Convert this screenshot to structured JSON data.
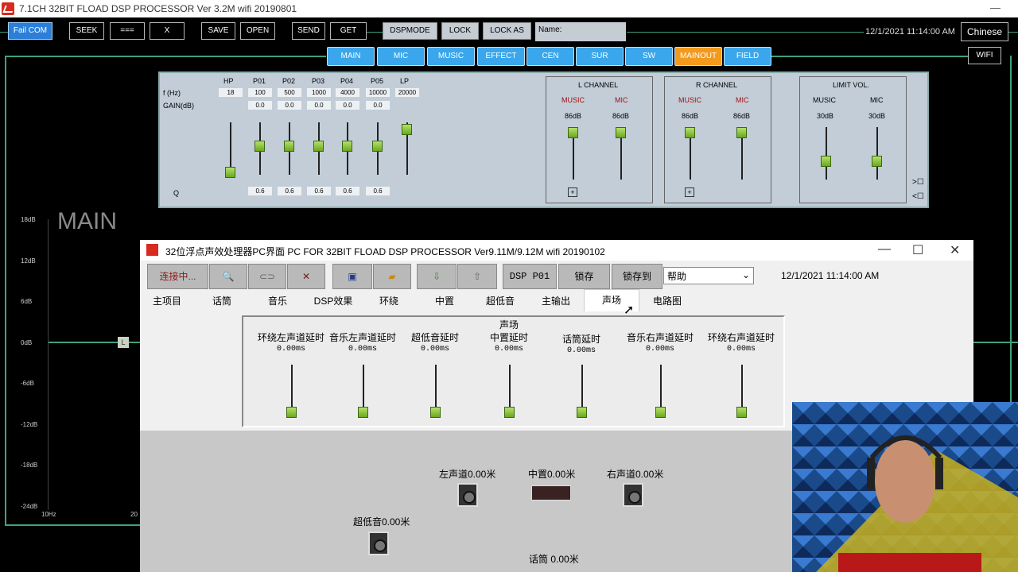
{
  "app": {
    "title": "7.1CH  32BIT FLOAD DSP PROCESSOR   Ver 3.2M   wifi    20190801",
    "minimize": "—"
  },
  "toolbar": {
    "fail_com": "Fail COM",
    "seek": "SEEK",
    "equals": "===",
    "x": "X",
    "save": "SAVE",
    "open": "OPEN",
    "send": "SEND",
    "get": "GET",
    "dspmode": "DSPMODE",
    "lock": "LOCK",
    "lock_as": "LOCK AS",
    "name_label": "Name:",
    "datetime": "12/1/2021 11:14:00 AM",
    "language": "Chinese",
    "wifi": "WIFI"
  },
  "tabs": [
    "MAIN",
    "MIC",
    "MUSIC",
    "EFFECT",
    "CEN",
    "SUR",
    "SW",
    "MAINOUT",
    "FIELD"
  ],
  "active_tab": "MAINOUT",
  "eq": {
    "headers": [
      "HP",
      "P01",
      "P02",
      "P03",
      "P04",
      "P05",
      "LP"
    ],
    "f_label": "f (Hz)",
    "gain_label": "GAIN(dB)",
    "q_label": "Q",
    "freqs": [
      "18",
      "100",
      "500",
      "1000",
      "4000",
      "10000",
      "20000"
    ],
    "gains": [
      "0.0",
      "0.0",
      "0.0",
      "0.0",
      "0.0"
    ],
    "qs": [
      "0.6",
      "0.6",
      "0.6",
      "0.6",
      "0.6"
    ]
  },
  "channels": {
    "l_title": "L CHANNEL",
    "r_title": "R CHANNEL",
    "limit_title": "LIMIT VOL.",
    "music": "MUSIC",
    "mic": "MIC",
    "l_values": [
      "86dB",
      "86dB"
    ],
    "r_values": [
      "86dB",
      "86dB"
    ],
    "limit_values": [
      "30dB",
      "30dB"
    ],
    "plus": "+"
  },
  "graph": {
    "title": "MAIN",
    "db_labels": [
      "18dB",
      "12dB",
      "6dB",
      "0dB",
      "-6dB",
      "-12dB",
      "-18dB",
      "-24dB"
    ],
    "x_start": "10Hz",
    "x_partial": "20",
    "l_marker": "L"
  },
  "child": {
    "title": "32位浮点声效处理器PC界面  PC FOR 32BIT FLOAD DSP PROCESSOR  Ver9.11M/9.12M  wifi    20190102",
    "connect": "连接中...",
    "dsp_p01": "DSP P01",
    "lock": "锁存",
    "lock_to": "锁存到",
    "help": "帮助",
    "datetime": "12/1/2021 11:14:00 AM",
    "tabs": [
      "主项目",
      "话筒",
      "音乐",
      "DSP效果",
      "环绕",
      "中置",
      "超低音",
      "主输出",
      "声场",
      "电路图"
    ],
    "selected_tab": "声场",
    "delays": [
      {
        "label": "环绕左声道延时",
        "value": "0.00ms"
      },
      {
        "label": "音乐左声道延时",
        "value": "0.00ms"
      },
      {
        "label": "超低音延时",
        "value": "0.00ms"
      },
      {
        "label_top": "声场",
        "label": "中置延时",
        "value": "0.00ms"
      },
      {
        "label": "话筒延时",
        "value": "0.00ms"
      },
      {
        "label": "音乐右声道延时",
        "value": "0.00ms"
      },
      {
        "label": "环绕右声道延时",
        "value": "0.00ms"
      }
    ],
    "speakers": {
      "left": "左声道0.00米",
      "center": "中置0.00米",
      "right": "右声道0.00米",
      "sub": "超低音0.00米",
      "mic": "话筒  0.00米"
    }
  }
}
